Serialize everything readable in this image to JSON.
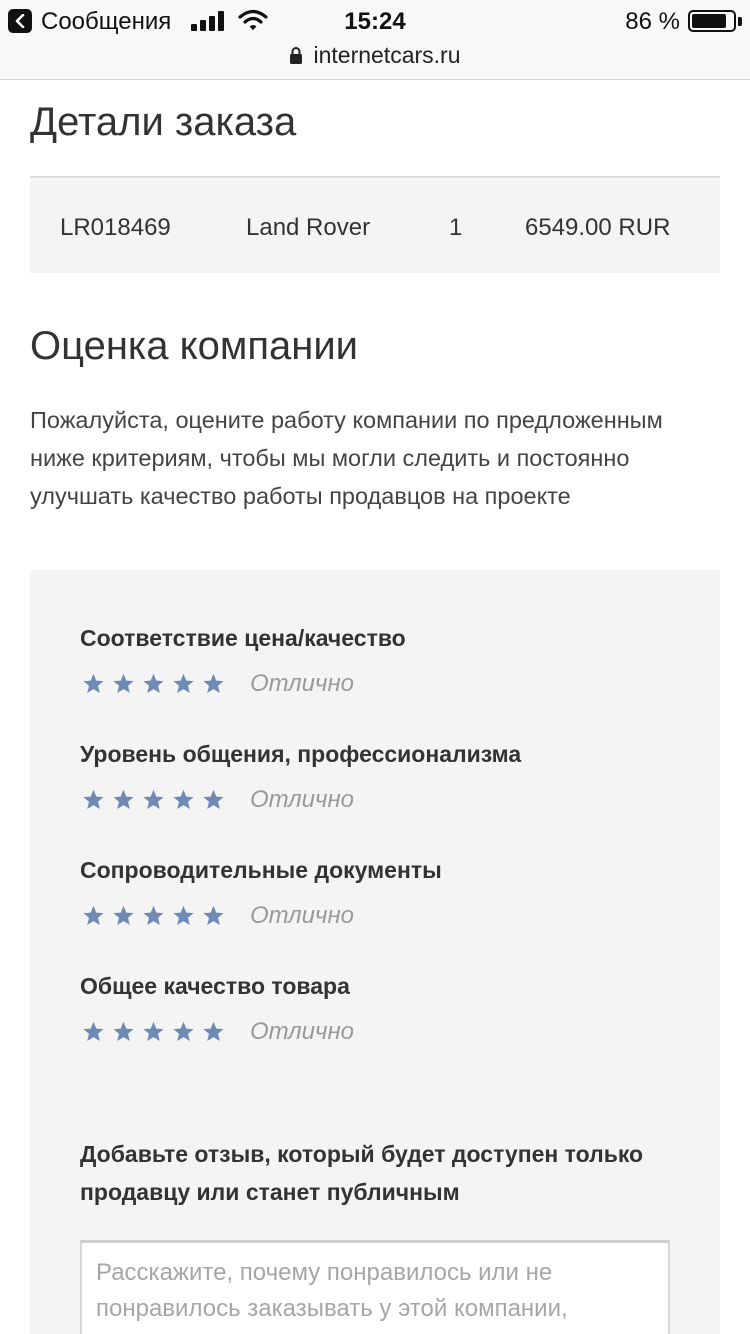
{
  "status_bar": {
    "back_app_label": "Сообщения",
    "time": "15:24",
    "battery_percent": "86 %",
    "battery_level": 0.86
  },
  "browser": {
    "url": "internetcars.ru"
  },
  "order": {
    "heading": "Детали заказа",
    "row": {
      "part_number": "LR018469",
      "brand": "Land Rover",
      "quantity": "1",
      "price": "6549.00 RUR"
    }
  },
  "rating": {
    "heading": "Оценка компании",
    "intro": "Пожалуйста, оцените работу компании по предложенным ниже критериям, чтобы мы могли следить и постоянно улучшать качество работы продавцов на проекте",
    "star_color": "#6f8bb3",
    "criteria": [
      {
        "title": "Соответствие цена/качество",
        "stars": 5,
        "label": "Отлично"
      },
      {
        "title": "Уровень общения, профессионализма",
        "stars": 5,
        "label": "Отлично"
      },
      {
        "title": "Сопроводительные документы",
        "stars": 5,
        "label": "Отлично"
      },
      {
        "title": "Общее качество товара",
        "stars": 5,
        "label": "Отлично"
      }
    ],
    "review": {
      "title": "Добавьте отзыв, который будет доступен только продавцу или станет публичным",
      "placeholder": "Расскажите, почему понравилось или не понравилось заказывать у этой компании,"
    }
  }
}
